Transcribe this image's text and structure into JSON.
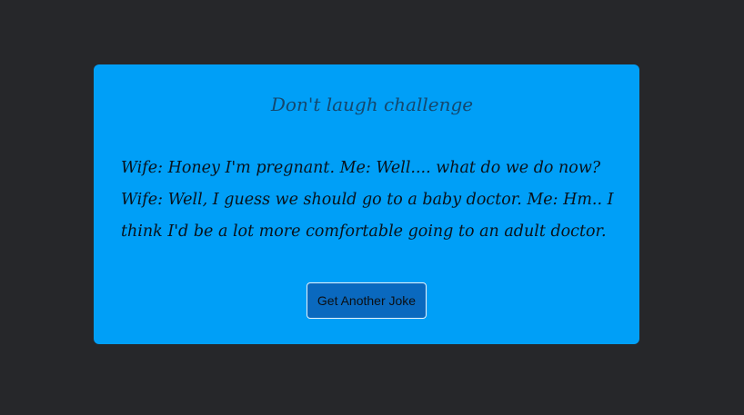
{
  "card": {
    "title": "Don't laugh challenge",
    "joke": "Wife: Honey I'm pregnant. Me: Well.... what do we do now? Wife: Well, I guess we should go to a baby doctor. Me: Hm.. I think I'd be a lot more comfortable going to an adult doctor.",
    "button_label": "Get Another Joke"
  },
  "colors": {
    "background": "#26272a",
    "card": "#009ff7",
    "title": "#14486e",
    "button": "#0a69bf"
  }
}
